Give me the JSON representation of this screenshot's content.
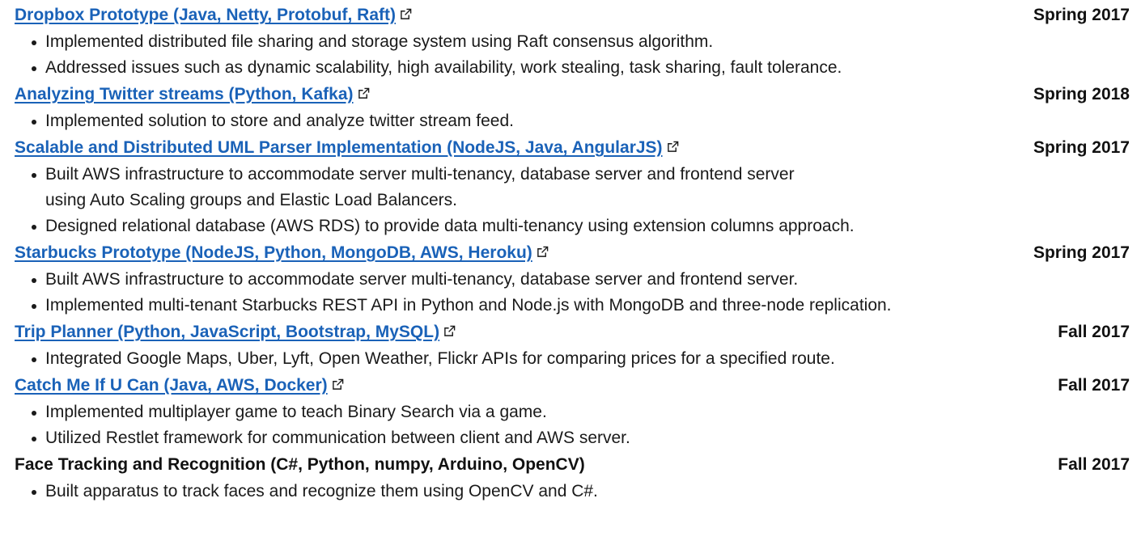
{
  "projects": [
    {
      "title": "Dropbox Prototype (Java, Netty, Protobuf, Raft)",
      "date": "Spring 2017",
      "link": true,
      "bullets": [
        "Implemented distributed file sharing and storage system using Raft consensus algorithm.",
        "Addressed issues such as dynamic scalability, high availability, work stealing, task sharing, fault tolerance."
      ]
    },
    {
      "title": "Analyzing Twitter streams (Python, Kafka)",
      "date": "Spring 2018",
      "link": true,
      "bullets": [
        "Implemented solution to store and analyze twitter stream feed."
      ]
    },
    {
      "title": "Scalable and Distributed UML Parser Implementation (NodeJS, Java, AngularJS)",
      "date": "Spring 2017",
      "link": true,
      "bullets": [
        "Built AWS infrastructure to accommodate server multi-tenancy, database server and frontend server using Auto Scaling groups and Elastic Load Balancers.",
        "Designed relational database (AWS RDS) to provide data multi-tenancy using extension columns approach."
      ]
    },
    {
      "title": "Starbucks Prototype (NodeJS, Python, MongoDB, AWS, Heroku)",
      "date": "Spring 2017",
      "link": true,
      "bullets": [
        "Built AWS infrastructure to accommodate server multi-tenancy, database server and frontend server.",
        "Implemented multi-tenant Starbucks REST API in Python and Node.js with MongoDB and three-node replication."
      ]
    },
    {
      "title": "Trip Planner (Python, JavaScript, Bootstrap, MySQL)",
      "date": "Fall 2017",
      "link": true,
      "bullets": [
        "Integrated Google Maps, Uber, Lyft, Open Weather, Flickr APIs for comparing prices for a specified route."
      ]
    },
    {
      "title": "Catch Me If U Can (Java, AWS, Docker)",
      "date": "Fall 2017",
      "link": true,
      "bullets": [
        "Implemented multiplayer game to teach Binary Search via a game.",
        "Utilized Restlet framework for communication between client and AWS server."
      ]
    },
    {
      "title": "Face Tracking and Recognition (C#, Python, numpy, Arduino, OpenCV)",
      "date": "Fall 2017",
      "link": false,
      "bullets": [
        "Built apparatus to track faces and recognize them using OpenCV and C#."
      ]
    }
  ],
  "icons": {
    "external_link": "external-link-icon",
    "bullet": "bullet-dot"
  },
  "colors": {
    "link": "#1a62b8",
    "text": "#1a1a1a"
  }
}
